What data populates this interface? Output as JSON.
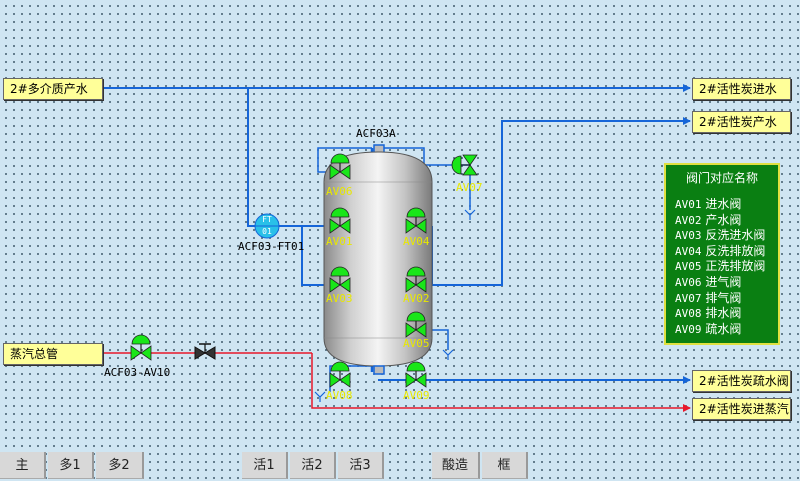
{
  "inputs": {
    "multimedia_water": "2#多介质产水",
    "steam_main": "蒸汽总管"
  },
  "outputs": {
    "inlet": "2#活性炭进水",
    "product": "2#活性炭产水",
    "drain": "2#活性炭疏水阀",
    "steam_in": "2#活性炭进蒸汽"
  },
  "tank": {
    "label": "ACF03A"
  },
  "flow_transmitter": {
    "code": "FT\n01",
    "label": "ACF03-FT01"
  },
  "steam_valve": {
    "label": "ACF03-AV10"
  },
  "valves": [
    "AV01",
    "AV02",
    "AV03",
    "AV04",
    "AV05",
    "AV06",
    "AV07",
    "AV08",
    "AV09"
  ],
  "legend": {
    "title": "阀门对应名称",
    "items": [
      {
        "code": "AV01",
        "name": "进水阀"
      },
      {
        "code": "AV02",
        "name": "产水阀"
      },
      {
        "code": "AV03",
        "name": "反洗进水阀"
      },
      {
        "code": "AV04",
        "name": "反洗排放阀"
      },
      {
        "code": "AV05",
        "name": "正洗排放阀"
      },
      {
        "code": "AV06",
        "name": "进气阀"
      },
      {
        "code": "AV07",
        "name": "排气阀"
      },
      {
        "code": "AV08",
        "name": "排水阀"
      },
      {
        "code": "AV09",
        "name": "疏水阀"
      }
    ]
  },
  "nav_tabs": [
    "主",
    "多1",
    "多2",
    "活1",
    "活2",
    "活3",
    "酸造",
    "框"
  ],
  "colors": {
    "water_pipe": "#1565d8",
    "steam_pipe": "#e8182b",
    "valve_open": "#19e619",
    "legend_bg": "#0a7f12"
  }
}
